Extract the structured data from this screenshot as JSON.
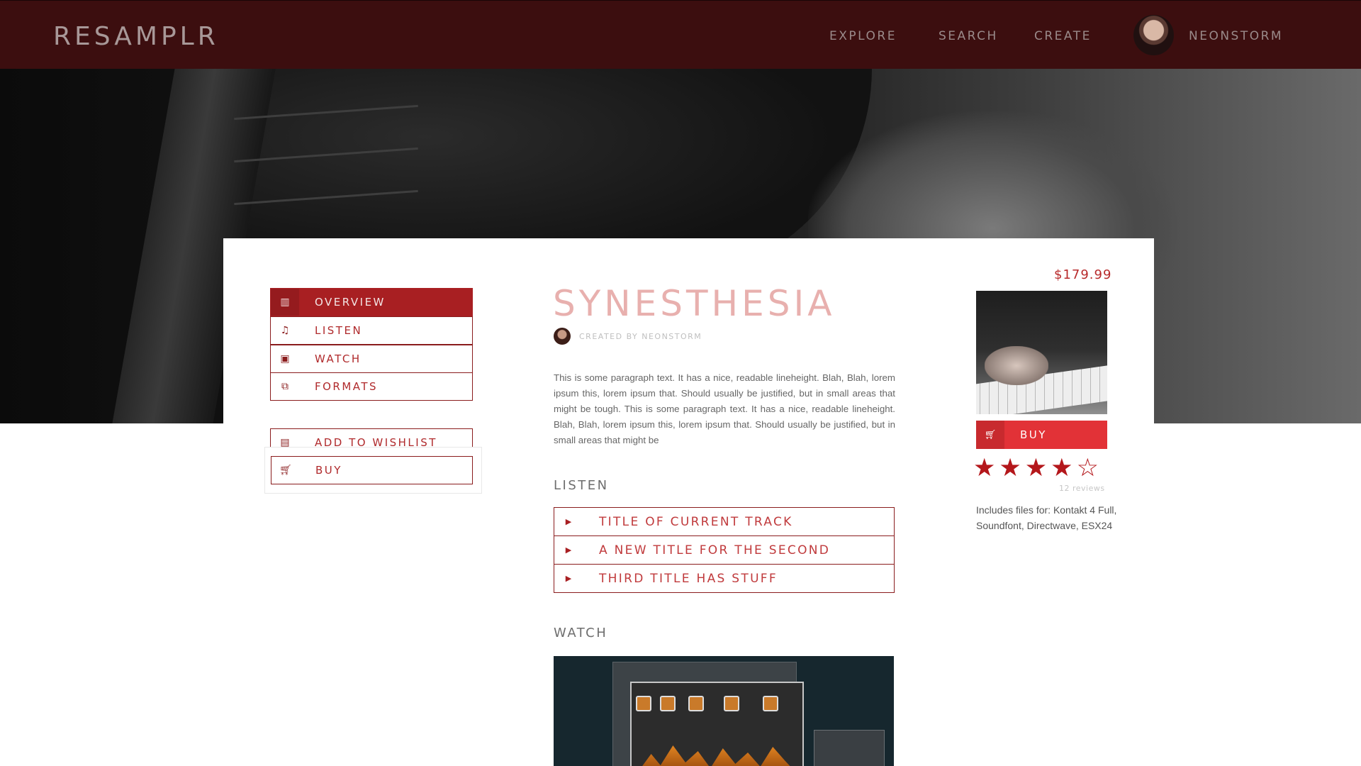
{
  "header": {
    "logo": "RESAMPLR",
    "nav": {
      "explore": "EXPLORE",
      "search": "SEARCH",
      "create": "CREATE"
    },
    "username": "NEONSTORM"
  },
  "sidebar": {
    "items": [
      {
        "label": "OVERVIEW",
        "icon": "map-icon",
        "active": true
      },
      {
        "label": "LISTEN",
        "icon": "music-note-icon",
        "active": false
      },
      {
        "label": "WATCH",
        "icon": "video-icon",
        "active": false
      },
      {
        "label": "FORMATS",
        "icon": "layers-icon",
        "active": false
      }
    ],
    "wishlist_label": "ADD TO WISHLIST",
    "buy_label": "BUY"
  },
  "product": {
    "title": "SYNESTHESIA",
    "creator": "CREATED BY NEONSTORM",
    "description": "This is some paragraph text.  It has a nice, readable lineheight.  Blah, Blah, lorem ipsum this, lorem ipsum that.  Should usually be justified, but in small areas that might be tough.  This is some paragraph text.  It has a nice, readable lineheight.  Blah, Blah, lorem ipsum this, lorem ipsum that.  Should usually be justified, but in small areas that might be",
    "price": "$179.99",
    "buy_label": "BUY",
    "rating": 4,
    "rating_max": 5,
    "reviews": "12 reviews",
    "includes": "Includes files for: Kontakt 4 Full, Soundfont, Directwave, ESX24"
  },
  "listen": {
    "heading": "LISTEN",
    "tracks": [
      "TITLE OF CURRENT TRACK",
      "A NEW TITLE FOR THE SECOND",
      "THIRD TITLE HAS STUFF"
    ]
  },
  "watch": {
    "heading": "WATCH"
  },
  "colors": {
    "header_bg": "#3c0e0f",
    "accent": "#a81f22",
    "buy_red": "#e23237"
  }
}
